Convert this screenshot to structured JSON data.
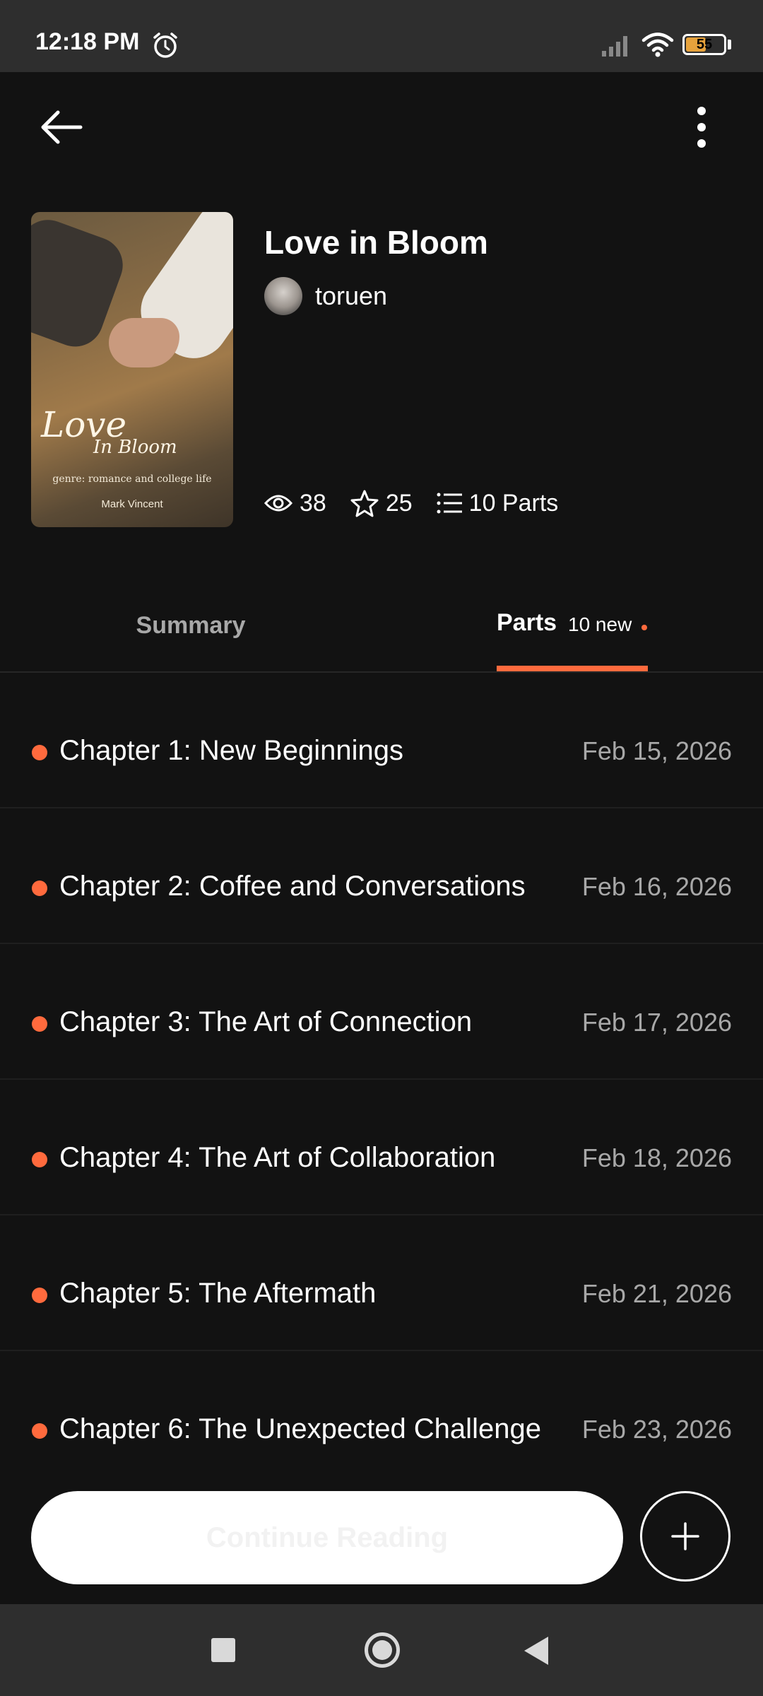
{
  "status_bar": {
    "time": "12:18 PM",
    "battery": "55"
  },
  "story": {
    "title": "Love in Bloom",
    "author": "toruen",
    "cover": {
      "title": "Love",
      "subtitle": "In Bloom",
      "genre": "genre: romance and college life",
      "author": "Mark Vincent"
    },
    "stats": {
      "views": "38",
      "votes": "25",
      "parts": "10 Parts"
    }
  },
  "tabs": {
    "summary": "Summary",
    "parts": "Parts",
    "new_count": "10 new"
  },
  "parts": [
    {
      "title": "Chapter 1: New Beginnings",
      "date": "Feb 15, 2026"
    },
    {
      "title": "Chapter 2: Coffee and Conversations",
      "date": "Feb 16, 2026"
    },
    {
      "title": "Chapter 3: The Art of Connection",
      "date": "Feb 17, 2026"
    },
    {
      "title": "Chapter 4: The Art of Collaboration",
      "date": "Feb 18, 2026"
    },
    {
      "title": "Chapter 5: The Aftermath",
      "date": "Feb 21, 2026"
    },
    {
      "title": "Chapter 6: The Unexpected Challenge",
      "date": "Feb 23, 2026"
    }
  ],
  "actions": {
    "continue_label": "Continue Reading"
  },
  "colors": {
    "accent": "#ff6a3d",
    "background": "#121212"
  }
}
